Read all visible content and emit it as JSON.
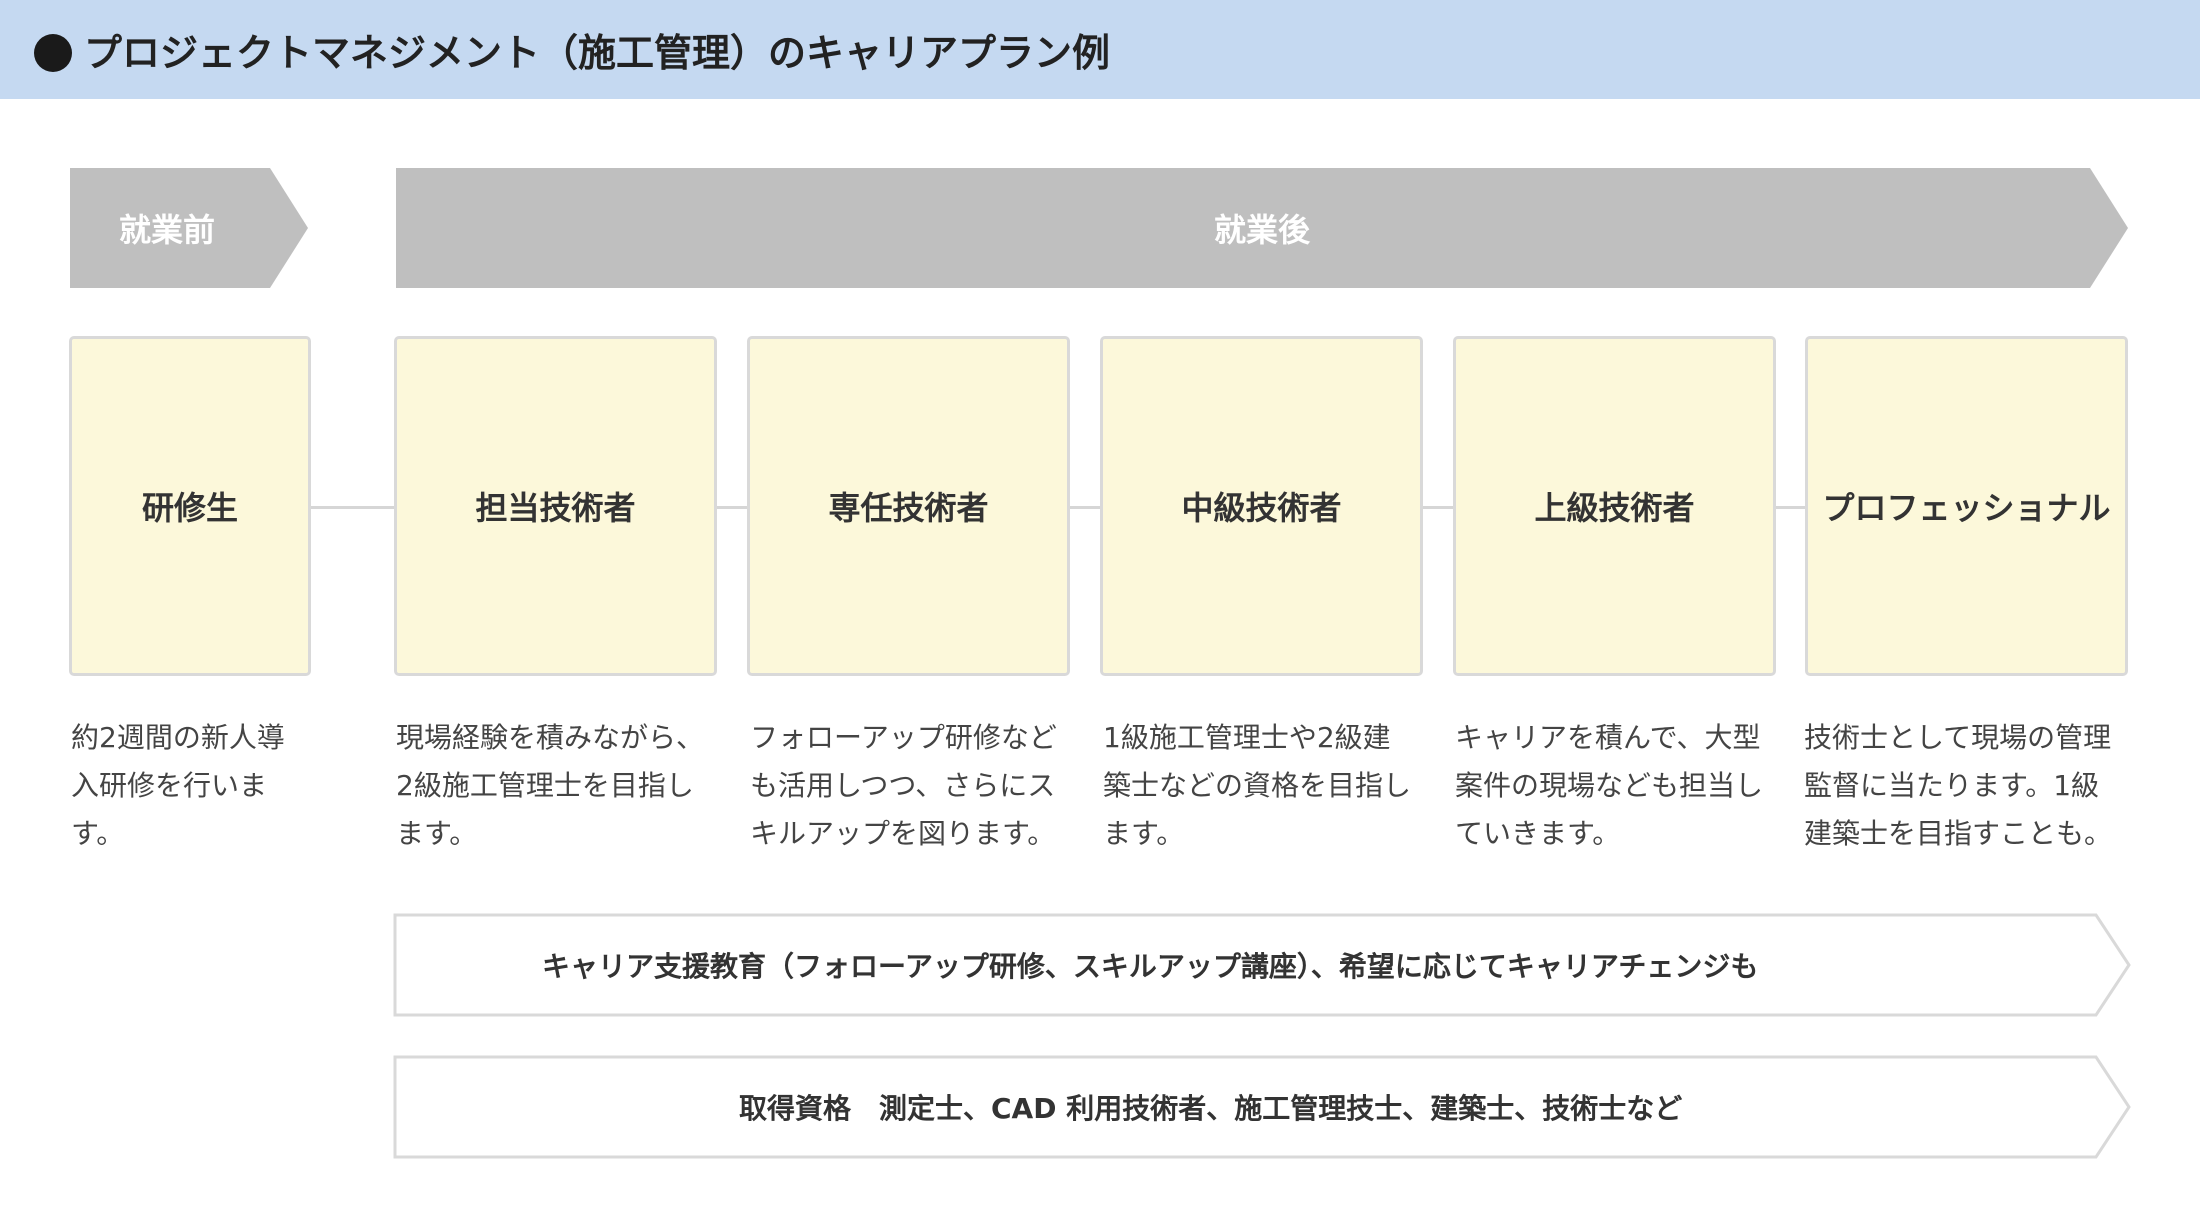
{
  "header": {
    "title": "プロジェクトマネジメント（施工管理）のキャリアプラン例"
  },
  "phases": {
    "before": "就業前",
    "after": "就業後"
  },
  "stages": [
    {
      "title": "研修生",
      "desc": [
        "約2週間の新人導",
        "入研修を行いま",
        "す。"
      ]
    },
    {
      "title": "担当技術者",
      "desc": [
        "現場経験を積みながら、",
        "2級施工管理士を目指し",
        "ます。"
      ]
    },
    {
      "title": "専任技術者",
      "desc": [
        "フォローアップ研修など",
        "も活用しつつ、さらにス",
        "キルアップを図ります。"
      ]
    },
    {
      "title": "中級技術者",
      "desc": [
        "1級施工管理士や2級建",
        "築士などの資格を目指し",
        "ます。"
      ]
    },
    {
      "title": "上級技術者",
      "desc": [
        "キャリアを積んで、大型",
        "案件の現場なども担当し",
        "ていきます。"
      ]
    },
    {
      "title": "プロフェッショナル",
      "desc": [
        "技術士として現場の管理",
        "監督に当たります。1級",
        "建築士を目指すことも。"
      ]
    }
  ],
  "banners": {
    "support": "キャリア支援教育（フォローアップ研修、スキルアップ講座）、希望に応じてキャリアチェンジも",
    "qualifications": "取得資格　測定士、CAD 利用技術者、施工管理技士、建築士、技術士など"
  }
}
